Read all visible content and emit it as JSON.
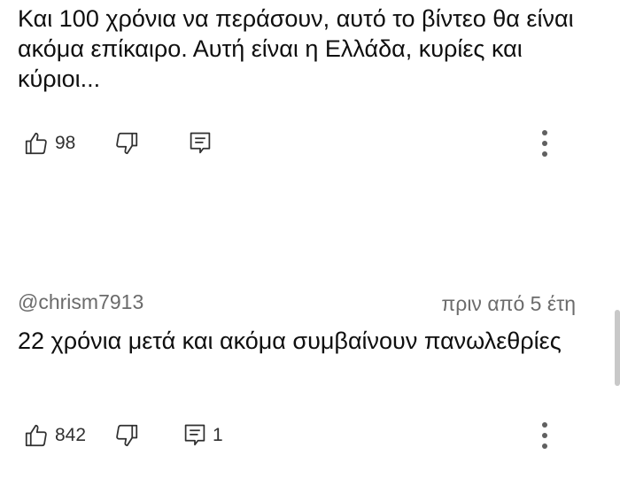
{
  "comments": [
    {
      "author": "",
      "time": "",
      "text": "Και 100 χρόνια να περάσουν, αυτό το βίντεο θα είναι ακόμα επίκαιρο. Αυτή είναι η Ελλάδα, κυρίες και κύριοι...",
      "likes": "98",
      "replies": ""
    },
    {
      "author": "@chrism7913",
      "time": "πριν από 5 έτη",
      "text": "22 χρόνια μετά και ακόμα συμβαίνουν πανωλεθρίες",
      "likes": "842",
      "replies": "1"
    }
  ],
  "icons": {
    "like": "thumb-up-icon",
    "dislike": "thumb-down-icon",
    "reply": "comment-reply-icon",
    "more": "more-vert-icon"
  },
  "colors": {
    "text": "#0f0f0f",
    "meta": "#6b6b6b",
    "icon": "#303030"
  }
}
